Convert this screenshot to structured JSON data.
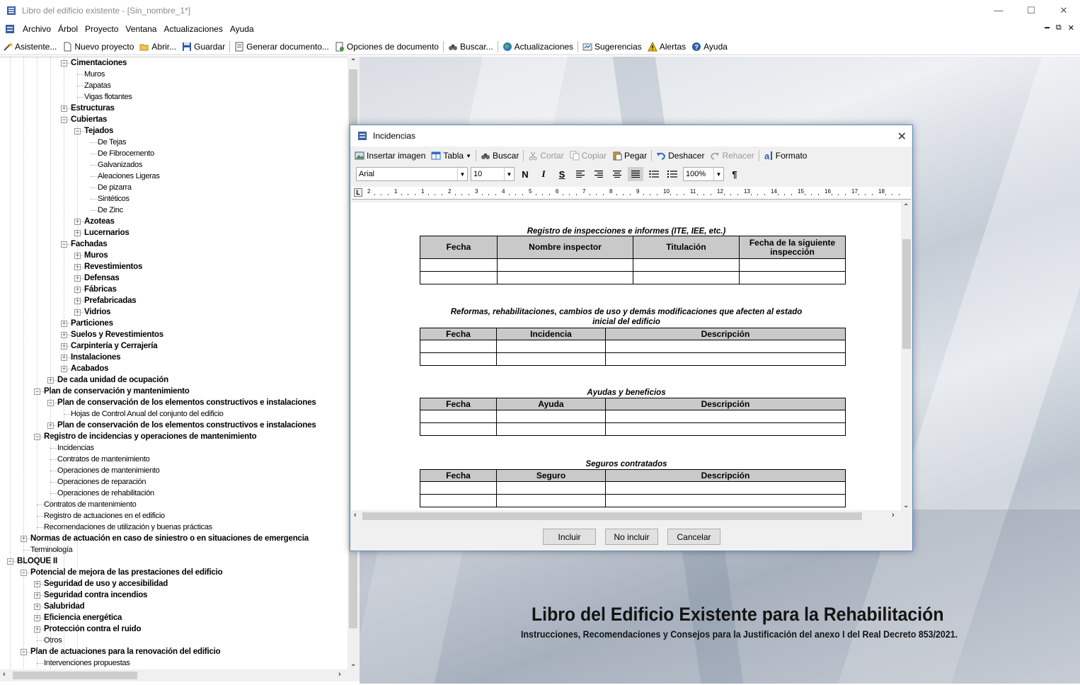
{
  "window": {
    "title": "Libro del edificio existente - [Sin_nombre_1*]"
  },
  "menu": [
    "Archivo",
    "Árbol",
    "Proyecto",
    "Ventana",
    "Actualizaciones",
    "Ayuda"
  ],
  "toolbar": {
    "asistente": "Asistente...",
    "nuevo": "Nuevo proyecto",
    "abrir": "Abrir...",
    "guardar": "Guardar",
    "generar": "Generar documento...",
    "opciones": "Opciones de documento",
    "buscar": "Buscar...",
    "actualizaciones": "Actualizaciones",
    "sugerencias": "Sugerencias",
    "alertas": "Alertas",
    "ayuda": "Ayuda"
  },
  "tree": [
    {
      "label": "Cimentaciones",
      "level": 4,
      "bold": true,
      "expander": "-"
    },
    {
      "label": "Muros",
      "level": 5,
      "bold": false
    },
    {
      "label": "Zapatas",
      "level": 5,
      "bold": false
    },
    {
      "label": "Vigas flotantes",
      "level": 5,
      "bold": false
    },
    {
      "label": "Estructuras",
      "level": 4,
      "bold": true,
      "expander": "+"
    },
    {
      "label": "Cubiertas",
      "level": 4,
      "bold": true,
      "expander": "-"
    },
    {
      "label": "Tejados",
      "level": 5,
      "bold": true,
      "expander": "-"
    },
    {
      "label": "De Tejas",
      "level": 6,
      "bold": false
    },
    {
      "label": "De Fibrocemento",
      "level": 6,
      "bold": false
    },
    {
      "label": "Galvanizados",
      "level": 6,
      "bold": false
    },
    {
      "label": "Aleaciones Ligeras",
      "level": 6,
      "bold": false
    },
    {
      "label": "De pizarra",
      "level": 6,
      "bold": false
    },
    {
      "label": "Sintéticos",
      "level": 6,
      "bold": false
    },
    {
      "label": "De Zinc",
      "level": 6,
      "bold": false
    },
    {
      "label": "Azoteas",
      "level": 5,
      "bold": true,
      "expander": "+"
    },
    {
      "label": "Lucernarios",
      "level": 5,
      "bold": true,
      "expander": "+"
    },
    {
      "label": "Fachadas",
      "level": 4,
      "bold": true,
      "expander": "-"
    },
    {
      "label": "Muros",
      "level": 5,
      "bold": true,
      "expander": "+"
    },
    {
      "label": "Revestimientos",
      "level": 5,
      "bold": true,
      "expander": "+"
    },
    {
      "label": "Defensas",
      "level": 5,
      "bold": true,
      "expander": "+"
    },
    {
      "label": "Fábricas",
      "level": 5,
      "bold": true,
      "expander": "+"
    },
    {
      "label": "Prefabricadas",
      "level": 5,
      "bold": true,
      "expander": "+"
    },
    {
      "label": "Vidrios",
      "level": 5,
      "bold": true,
      "expander": "+"
    },
    {
      "label": "Particiones",
      "level": 4,
      "bold": true,
      "expander": "+"
    },
    {
      "label": "Suelos y Revestimientos",
      "level": 4,
      "bold": true,
      "expander": "+"
    },
    {
      "label": "Carpintería y Cerrajería",
      "level": 4,
      "bold": true,
      "expander": "+"
    },
    {
      "label": "Instalaciones",
      "level": 4,
      "bold": true,
      "expander": "+"
    },
    {
      "label": "Acabados",
      "level": 4,
      "bold": true,
      "expander": "+"
    },
    {
      "label": "De cada unidad de ocupación",
      "level": 3,
      "bold": true,
      "expander": "+"
    },
    {
      "label": "Plan de conservación y mantenimiento",
      "level": 2,
      "bold": true,
      "expander": "-"
    },
    {
      "label": "Plan de conservación de los elementos constructivos e instalaciones",
      "level": 3,
      "bold": true,
      "expander": "-"
    },
    {
      "label": "Hojas de Control Anual del conjunto del edificio",
      "level": 4,
      "bold": false
    },
    {
      "label": "Plan de conservación de los elementos constructivos e instalaciones",
      "level": 3,
      "bold": true,
      "expander": "+"
    },
    {
      "label": "Registro de incidencias y operaciones de mantenimiento",
      "level": 2,
      "bold": true,
      "expander": "-"
    },
    {
      "label": "Incidencias",
      "level": 3,
      "bold": false
    },
    {
      "label": "Contratos de mantenimiento",
      "level": 3,
      "bold": false
    },
    {
      "label": "Operaciones de mantenimiento",
      "level": 3,
      "bold": false
    },
    {
      "label": "Operaciones de reparación",
      "level": 3,
      "bold": false
    },
    {
      "label": "Operaciones de rehabilitación",
      "level": 3,
      "bold": false
    },
    {
      "label": "Contratos de mantenimiento",
      "level": 2,
      "bold": false
    },
    {
      "label": "Registro de actuaciones en el edificio",
      "level": 2,
      "bold": false
    },
    {
      "label": "Recomendaciones de utilización y buenas prácticas",
      "level": 2,
      "bold": false
    },
    {
      "label": "Normas de actuación en caso de siniestro o en situaciones de emergencia",
      "level": 1,
      "bold": true,
      "expander": "+"
    },
    {
      "label": "Terminología",
      "level": 1,
      "bold": false
    },
    {
      "label": "BLOQUE II",
      "level": 0,
      "bold": true,
      "expander": "-"
    },
    {
      "label": "Potencial de mejora de las prestaciones del edificio",
      "level": 1,
      "bold": true,
      "expander": "-"
    },
    {
      "label": "Seguridad de uso y accesibilidad",
      "level": 2,
      "bold": true,
      "expander": "+"
    },
    {
      "label": "Seguridad contra incendios",
      "level": 2,
      "bold": true,
      "expander": "+"
    },
    {
      "label": "Salubridad",
      "level": 2,
      "bold": true,
      "expander": "+"
    },
    {
      "label": "Eficiencia energética",
      "level": 2,
      "bold": true,
      "expander": "+"
    },
    {
      "label": "Protección contra el ruido",
      "level": 2,
      "bold": true,
      "expander": "+"
    },
    {
      "label": "Otros",
      "level": 2,
      "bold": false
    },
    {
      "label": "Plan de actuaciones para la renovación del edificio",
      "level": 1,
      "bold": true,
      "expander": "-"
    },
    {
      "label": "Intervenciones propuestas",
      "level": 2,
      "bold": false
    }
  ],
  "background": {
    "title": "Libro del Edificio Existente para la Rehabilitación",
    "subtitle": "Instrucciones, Recomendaciones y Consejos para la Justificación del anexo I del Real Decreto 853/2021."
  },
  "dialog": {
    "title": "Incidencias",
    "toolbar": {
      "insertar": "Insertar imagen",
      "tabla": "Tabla",
      "buscar": "Buscar",
      "cortar": "Cortar",
      "copiar": "Copiar",
      "pegar": "Pegar",
      "deshacer": "Deshacer",
      "rehacer": "Rehacer",
      "formato": "Formato"
    },
    "font": "Arial",
    "size": "10",
    "zoom": "100%",
    "ruler_marks": [
      "2",
      "1",
      "1",
      "2",
      "3",
      "4",
      "5",
      "6",
      "7",
      "8",
      "9",
      "10",
      "11",
      "12",
      "13",
      "14",
      "15",
      "16",
      "17",
      "18"
    ],
    "sections": [
      {
        "title": "Registro de inspecciones e informes (ITE, IEE, etc.)",
        "headers": [
          "Fecha",
          "Nombre inspector",
          "Titulación",
          "Fecha de la siguiente inspección"
        ]
      },
      {
        "title": "Reformas, rehabilitaciones, cambios de uso y demás modificaciones que afecten al estado inicial del edificio",
        "headers": [
          "Fecha",
          "Incidencia",
          "Descripción"
        ]
      },
      {
        "title": "Ayudas y beneficios",
        "headers": [
          "Fecha",
          "Ayuda",
          "Descripción"
        ]
      },
      {
        "title": "Seguros contratados",
        "headers": [
          "Fecha",
          "Seguro",
          "Descripción"
        ]
      }
    ],
    "buttons": {
      "incluir": "Incluir",
      "no_incluir": "No incluir",
      "cancelar": "Cancelar"
    }
  }
}
